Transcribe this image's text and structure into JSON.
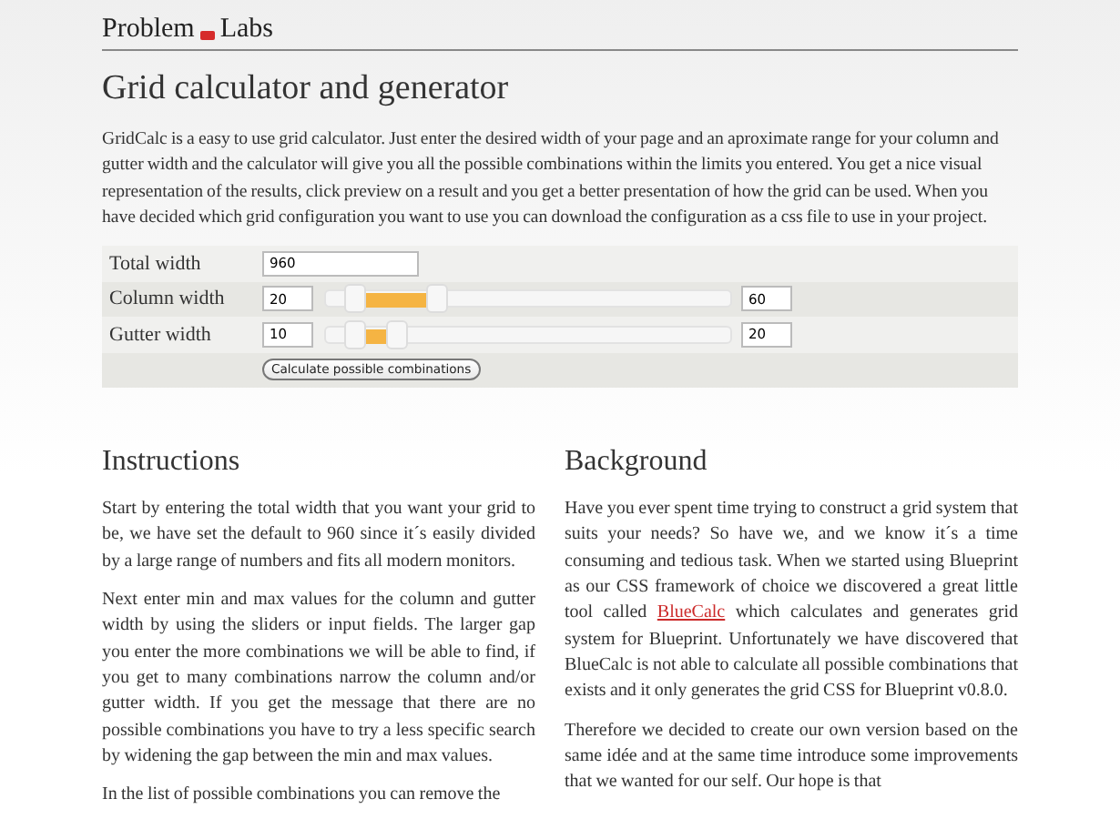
{
  "header": {
    "brand_left": "Problem",
    "brand_right": "Labs"
  },
  "title": "Grid calculator and generator",
  "intro": "GridCalc is a easy to use grid calculator. Just enter the desired width of your page and an aproximate range for your column and gutter width and the calculator will give you all the possible combinations within the limits you entered. You get a nice visual representation of the results, click preview on a result and you get a better presentation of how the grid can be used. When you have decided which grid configuration you want to use you can download the configuration as a css file to use in your project.",
  "form": {
    "rows": [
      {
        "kind": "input",
        "label": "Total width",
        "value": "960"
      },
      {
        "kind": "range",
        "label": "Column width",
        "min": "20",
        "max": "60",
        "thumbs": [
          {
            "level": 0.094
          },
          {
            "level": 0.296
          }
        ]
      },
      {
        "kind": "range",
        "label": "Gutter width",
        "min": "10",
        "max": "20",
        "thumbs": [
          {
            "level": 0.094
          },
          {
            "level": 0.2
          }
        ]
      }
    ],
    "button": "Calculate possible combinations"
  },
  "columns": [
    {
      "heading": "Instructions",
      "paragraphs": [
        [
          {
            "text": "Start by entering the total width that you want your grid to be, we have set the default to 960 since it´s easily divided by a large range of numbers and fits all modern monitors."
          }
        ],
        [
          {
            "text": "Next enter min and max values for the column and gutter width by using the sliders or input fields. The larger gap you enter the more combinations we will be able to find, if you get to many combinations narrow the column and/or gutter width. If you get the message that there are no possible combinations you have to try a less specific search by widening the gap between the min and max values."
          }
        ],
        [
          {
            "text": "In the list of possible combinations you can remove the"
          }
        ]
      ]
    },
    {
      "heading": "Background",
      "paragraphs": [
        [
          {
            "text": "Have you ever spent time trying to construct a grid system that suits your needs? So have we, and we know it´s a time consuming and tedious task. When we started using Blueprint as our CSS framework of choice we discovered a great little tool called "
          },
          {
            "text": "BlueCalc",
            "kind": "link"
          },
          {
            "text": " which calculates and generates grid system for Blueprint. Unfortunately we have discovered that BlueCalc is not able to calculate all possible combinations that exists and it only generates the grid CSS for Blueprint v0.8.0."
          }
        ],
        [
          {
            "text": "Therefore we decided to create our own version based on the same idée and at the same time introduce some improvements that we wanted for our self. Our hope is that"
          }
        ]
      ]
    }
  ]
}
